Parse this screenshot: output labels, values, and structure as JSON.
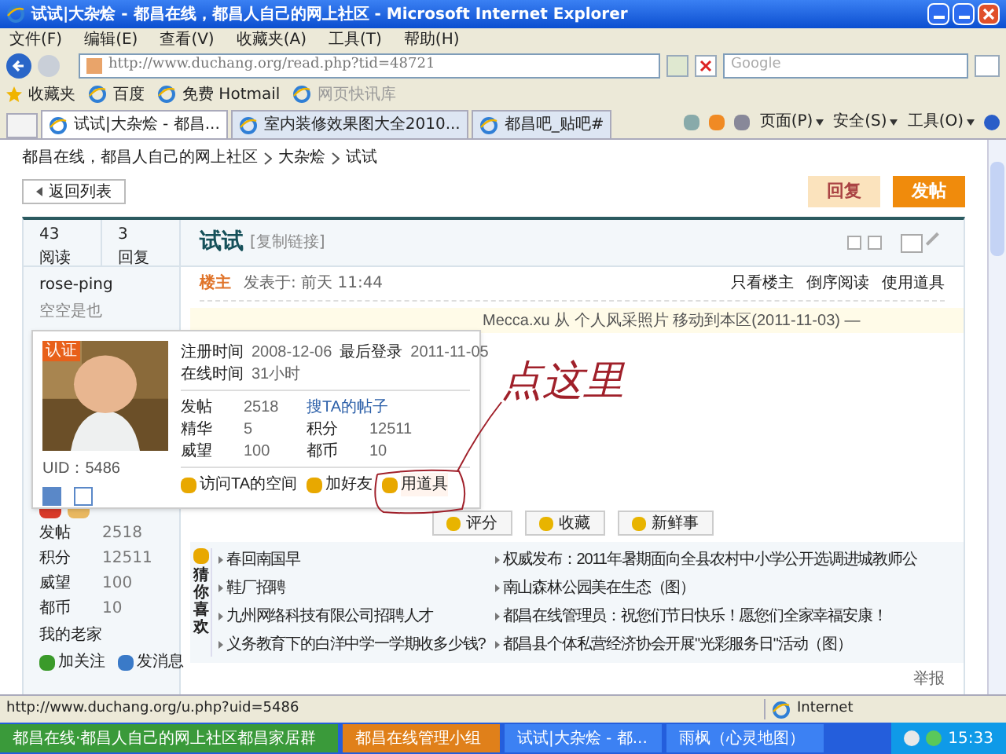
{
  "window": {
    "title": "试试|大杂烩 - 都昌在线，都昌人自己的网上社区 - Microsoft Internet Explorer"
  },
  "menu": [
    "文件(F)",
    "编辑(E)",
    "查看(V)",
    "收藏夹(A)",
    "工具(T)",
    "帮助(H)"
  ],
  "address": {
    "url": "http://www.duchang.org/read.php?tid=48721"
  },
  "search": {
    "placeholder": "Google"
  },
  "favorites_bar": {
    "label": "收藏夹",
    "links": [
      "百度",
      "免费 Hotmail",
      "网页快讯库"
    ]
  },
  "tabs": [
    {
      "label": "试试|大杂烩 - 都昌...",
      "selected": true
    },
    {
      "label": "室内装修效果图大全2010...",
      "selected": false
    },
    {
      "label": "都昌吧_贴吧#",
      "selected": false
    }
  ],
  "command_bar": [
    "页面(P)",
    "安全(S)",
    "工具(O)"
  ],
  "breadcrumb": [
    "都昌在线，都昌人自己的网上社区",
    "大杂烩",
    "试试"
  ],
  "back_button": "返回列表",
  "buttons": [
    {
      "label": "回复",
      "kind": "secondary"
    },
    {
      "label": "发帖",
      "kind": "primary"
    }
  ],
  "thread": {
    "views": "43",
    "views_label": "阅读",
    "replies": "3",
    "replies_label": "回复",
    "title": "试试",
    "copy_link": "[复制链接]"
  },
  "post": {
    "author_tag": "楼主",
    "posted": "发表于: 前天 11:44",
    "actions": [
      "只看楼主",
      "倒序阅读",
      "使用道具"
    ],
    "move_note": "Mecca.xu 从 个人风采照片 移动到本区(2011-11-03) —",
    "annotation": "点这里"
  },
  "author": {
    "name": "rose-ping",
    "title": "空空是也",
    "stats": [
      {
        "label": "发帖",
        "value": "2518"
      },
      {
        "label": "积分",
        "value": "12511"
      },
      {
        "label": "威望",
        "value": "100"
      },
      {
        "label": "都币",
        "value": "10"
      }
    ],
    "hometown": "我的老家",
    "actions": [
      "加关注",
      "发消息"
    ]
  },
  "profile_card": {
    "badge": "认证",
    "uid": "UID：5486",
    "info": [
      [
        "注册时间",
        "2008-12-06",
        "最后登录",
        "2011-11-05"
      ],
      [
        "在线时间",
        "31小时"
      ]
    ],
    "stats": [
      [
        "发帖",
        "2518",
        "搜TA的帖子"
      ],
      [
        "精华",
        "5",
        "积分",
        "12511"
      ],
      [
        "威望",
        "100",
        "都币",
        "10"
      ]
    ],
    "links": [
      {
        "label": "访问TA的空间",
        "highlighted": false
      },
      {
        "label": "加好友",
        "highlighted": false
      },
      {
        "label": "用道具",
        "highlighted": true
      }
    ]
  },
  "post_actions": [
    "评分",
    "收藏",
    "新鲜事"
  ],
  "recommend": {
    "label": "猜你喜欢",
    "links": [
      "春回南国早",
      "鞋厂招聘",
      "九州网络科技有限公司招聘人才",
      "义务教育下的白洋中学一学期收多少钱?",
      "权威发布：2011年暑期面向全县农村中小学公开选调进城教师公",
      "南山森林公园美在生态（图）",
      "都昌在线管理员：祝您们节日快乐！愿您们全家幸福安康！",
      "都昌县个体私营经济协会开展\"光彩服务日\"活动（图）"
    ]
  },
  "report": "举报",
  "status_bar": {
    "text": "http://www.duchang.org/u.php?uid=5486",
    "zone": "Internet"
  },
  "taskbar": {
    "items": [
      {
        "label": "都昌在线·都昌人自己的网上社区都昌家居群",
        "selected": false
      },
      {
        "label": "都昌在线管理小组",
        "selected": true
      },
      {
        "label": "试试|大杂烩 - 都...",
        "selected": false
      },
      {
        "label": "雨枫（心灵地图）",
        "selected": false
      }
    ],
    "clock": "15:33"
  }
}
